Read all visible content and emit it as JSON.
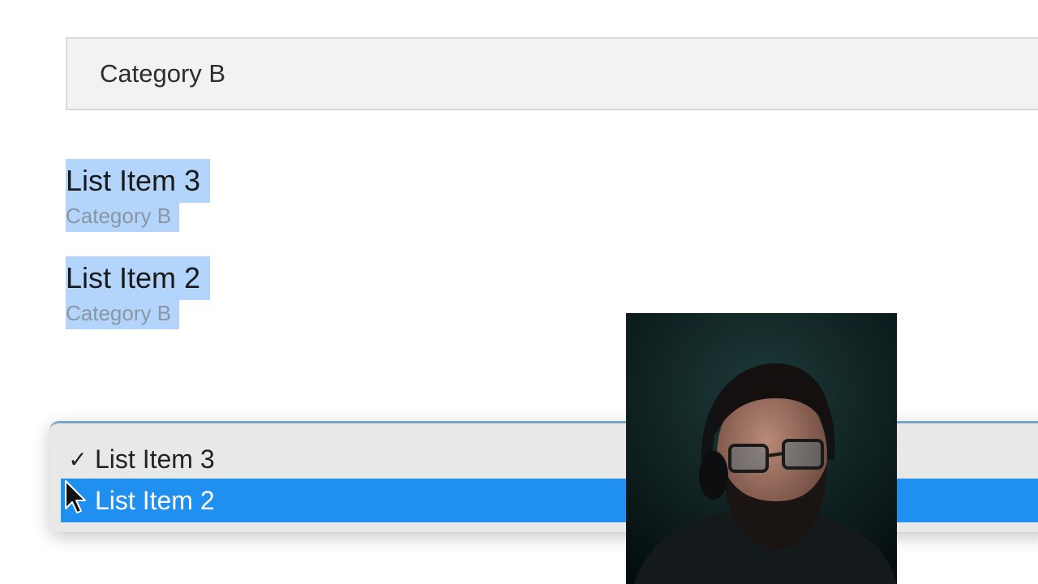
{
  "category_select": {
    "value": "Category B"
  },
  "results": [
    {
      "title": "List Item 3",
      "category": "Category B"
    },
    {
      "title": "List Item 2",
      "category": "Category B"
    }
  ],
  "dropdown": {
    "options": [
      {
        "label": "List Item 3",
        "checked": true,
        "check_glyph": "✓"
      },
      {
        "label": "List Item 2",
        "highlighted": true
      }
    ]
  },
  "colors": {
    "selection_highlight": "#b4d5fb",
    "menu_highlight": "#1f8ff0",
    "field_background": "#f2f2f2"
  },
  "icons": {
    "check": "check-icon",
    "cursor": "mouse-pointer-icon"
  }
}
